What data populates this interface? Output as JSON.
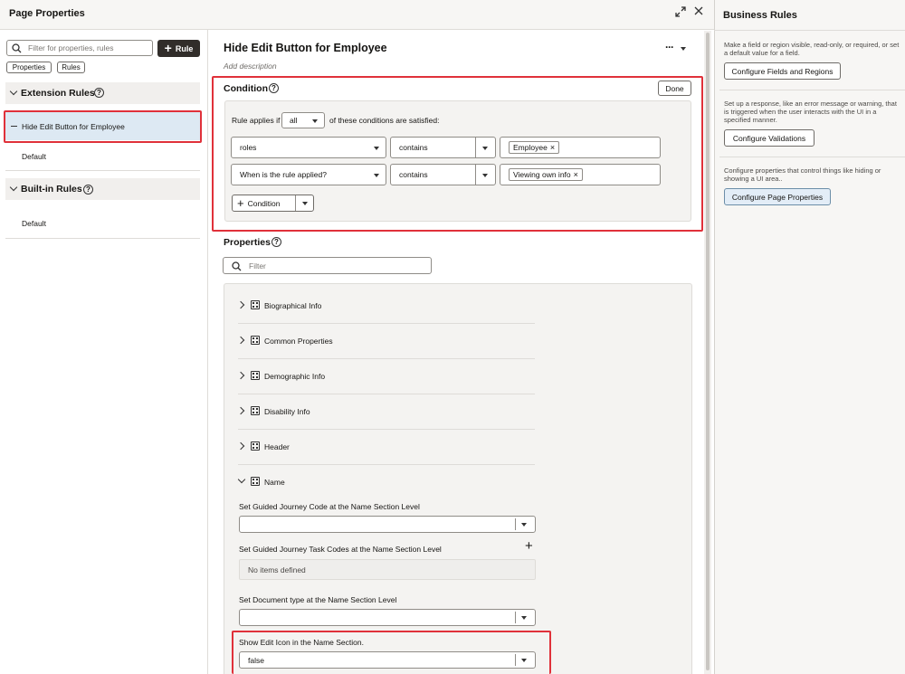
{
  "left_panel": {
    "title": "Page Properties",
    "search_placeholder": "Filter for properties, rules",
    "add_rule_label": "Rule",
    "tabs": [
      "Properties",
      "Rules"
    ],
    "extension_section": "Extension Rules",
    "extension_items": [
      "Hide Edit Button for Employee",
      "Default"
    ],
    "builtin_section": "Built-in Rules",
    "builtin_items": [
      "Default"
    ]
  },
  "main": {
    "title": "Hide Edit Button for Employee",
    "description_placeholder": "Add description",
    "condition_heading": "Condition",
    "done_label": "Done",
    "rule_applies_prefix": "Rule applies if",
    "rule_applies_value": "all",
    "rule_applies_suffix": "of these conditions are satisfied:",
    "conditions": [
      {
        "field": "roles",
        "operator": "contains",
        "value": "Employee"
      },
      {
        "field": "When is the rule applied?",
        "operator": "contains",
        "value": "Viewing own info"
      }
    ],
    "add_condition_label": "Condition",
    "properties_heading": "Properties",
    "filter_placeholder": "Filter",
    "groups": [
      "Biographical Info",
      "Common Properties",
      "Demographic Info",
      "Disability Info",
      "Header",
      "Name"
    ],
    "name_fields": {
      "guided_journey_code_label": "Set Guided Journey Code at the Name Section Level",
      "guided_journey_code_value": "",
      "guided_task_codes_label": "Set Guided Journey Task Codes at the Name Section Level",
      "guided_task_codes_empty": "No items defined",
      "document_type_label": "Set Document type at the Name Section Level",
      "document_type_value": "",
      "show_edit_icon_label": "Show Edit Icon in the Name Section.",
      "show_edit_icon_value": "false"
    }
  },
  "right_panel": {
    "title": "Business Rules",
    "sections": [
      {
        "text": "Make a field or region visible, read-only, or required, or set a default value for a field.",
        "button": "Configure Fields and Regions"
      },
      {
        "text": "Set up a response, like an error message or warning, that is triggered when the user interacts with the UI in a specified manner.",
        "button": "Configure Validations"
      },
      {
        "text": "Configure properties that control things like hiding or showing a UI area..",
        "button": "Configure Page Properties"
      }
    ]
  },
  "colors": {
    "highlight_red": "#e0313a",
    "selected_bg": "#dde9f3",
    "primary_button_bg": "#e3edf7",
    "dark_button": "#312d2a"
  }
}
